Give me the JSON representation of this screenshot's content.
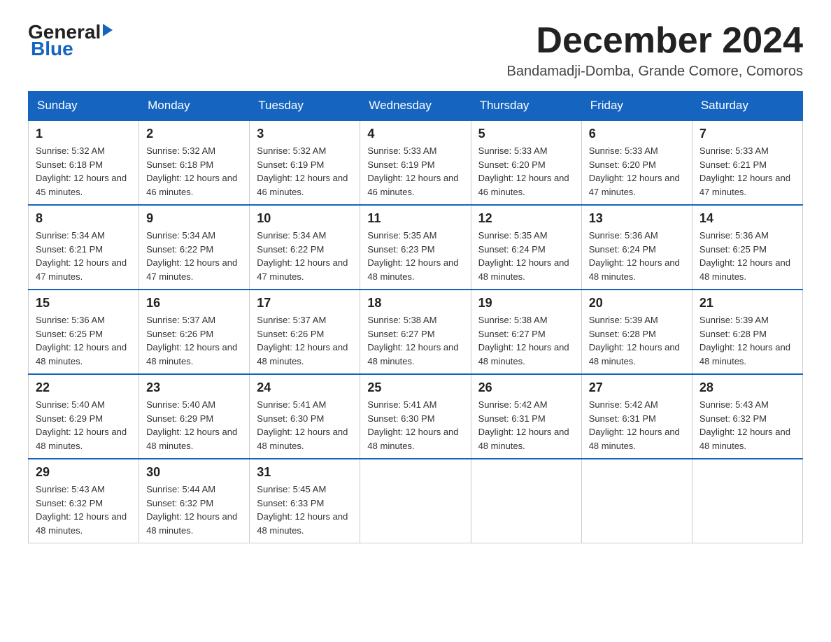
{
  "header": {
    "logo": {
      "general": "General",
      "blue": "Blue"
    },
    "title": "December 2024",
    "location": "Bandamadji-Domba, Grande Comore, Comoros"
  },
  "days_of_week": [
    "Sunday",
    "Monday",
    "Tuesday",
    "Wednesday",
    "Thursday",
    "Friday",
    "Saturday"
  ],
  "weeks": [
    [
      {
        "day": "1",
        "sunrise": "5:32 AM",
        "sunset": "6:18 PM",
        "daylight": "12 hours and 45 minutes."
      },
      {
        "day": "2",
        "sunrise": "5:32 AM",
        "sunset": "6:18 PM",
        "daylight": "12 hours and 46 minutes."
      },
      {
        "day": "3",
        "sunrise": "5:32 AM",
        "sunset": "6:19 PM",
        "daylight": "12 hours and 46 minutes."
      },
      {
        "day": "4",
        "sunrise": "5:33 AM",
        "sunset": "6:19 PM",
        "daylight": "12 hours and 46 minutes."
      },
      {
        "day": "5",
        "sunrise": "5:33 AM",
        "sunset": "6:20 PM",
        "daylight": "12 hours and 46 minutes."
      },
      {
        "day": "6",
        "sunrise": "5:33 AM",
        "sunset": "6:20 PM",
        "daylight": "12 hours and 47 minutes."
      },
      {
        "day": "7",
        "sunrise": "5:33 AM",
        "sunset": "6:21 PM",
        "daylight": "12 hours and 47 minutes."
      }
    ],
    [
      {
        "day": "8",
        "sunrise": "5:34 AM",
        "sunset": "6:21 PM",
        "daylight": "12 hours and 47 minutes."
      },
      {
        "day": "9",
        "sunrise": "5:34 AM",
        "sunset": "6:22 PM",
        "daylight": "12 hours and 47 minutes."
      },
      {
        "day": "10",
        "sunrise": "5:34 AM",
        "sunset": "6:22 PM",
        "daylight": "12 hours and 47 minutes."
      },
      {
        "day": "11",
        "sunrise": "5:35 AM",
        "sunset": "6:23 PM",
        "daylight": "12 hours and 48 minutes."
      },
      {
        "day": "12",
        "sunrise": "5:35 AM",
        "sunset": "6:24 PM",
        "daylight": "12 hours and 48 minutes."
      },
      {
        "day": "13",
        "sunrise": "5:36 AM",
        "sunset": "6:24 PM",
        "daylight": "12 hours and 48 minutes."
      },
      {
        "day": "14",
        "sunrise": "5:36 AM",
        "sunset": "6:25 PM",
        "daylight": "12 hours and 48 minutes."
      }
    ],
    [
      {
        "day": "15",
        "sunrise": "5:36 AM",
        "sunset": "6:25 PM",
        "daylight": "12 hours and 48 minutes."
      },
      {
        "day": "16",
        "sunrise": "5:37 AM",
        "sunset": "6:26 PM",
        "daylight": "12 hours and 48 minutes."
      },
      {
        "day": "17",
        "sunrise": "5:37 AM",
        "sunset": "6:26 PM",
        "daylight": "12 hours and 48 minutes."
      },
      {
        "day": "18",
        "sunrise": "5:38 AM",
        "sunset": "6:27 PM",
        "daylight": "12 hours and 48 minutes."
      },
      {
        "day": "19",
        "sunrise": "5:38 AM",
        "sunset": "6:27 PM",
        "daylight": "12 hours and 48 minutes."
      },
      {
        "day": "20",
        "sunrise": "5:39 AM",
        "sunset": "6:28 PM",
        "daylight": "12 hours and 48 minutes."
      },
      {
        "day": "21",
        "sunrise": "5:39 AM",
        "sunset": "6:28 PM",
        "daylight": "12 hours and 48 minutes."
      }
    ],
    [
      {
        "day": "22",
        "sunrise": "5:40 AM",
        "sunset": "6:29 PM",
        "daylight": "12 hours and 48 minutes."
      },
      {
        "day": "23",
        "sunrise": "5:40 AM",
        "sunset": "6:29 PM",
        "daylight": "12 hours and 48 minutes."
      },
      {
        "day": "24",
        "sunrise": "5:41 AM",
        "sunset": "6:30 PM",
        "daylight": "12 hours and 48 minutes."
      },
      {
        "day": "25",
        "sunrise": "5:41 AM",
        "sunset": "6:30 PM",
        "daylight": "12 hours and 48 minutes."
      },
      {
        "day": "26",
        "sunrise": "5:42 AM",
        "sunset": "6:31 PM",
        "daylight": "12 hours and 48 minutes."
      },
      {
        "day": "27",
        "sunrise": "5:42 AM",
        "sunset": "6:31 PM",
        "daylight": "12 hours and 48 minutes."
      },
      {
        "day": "28",
        "sunrise": "5:43 AM",
        "sunset": "6:32 PM",
        "daylight": "12 hours and 48 minutes."
      }
    ],
    [
      {
        "day": "29",
        "sunrise": "5:43 AM",
        "sunset": "6:32 PM",
        "daylight": "12 hours and 48 minutes."
      },
      {
        "day": "30",
        "sunrise": "5:44 AM",
        "sunset": "6:32 PM",
        "daylight": "12 hours and 48 minutes."
      },
      {
        "day": "31",
        "sunrise": "5:45 AM",
        "sunset": "6:33 PM",
        "daylight": "12 hours and 48 minutes."
      },
      null,
      null,
      null,
      null
    ]
  ]
}
